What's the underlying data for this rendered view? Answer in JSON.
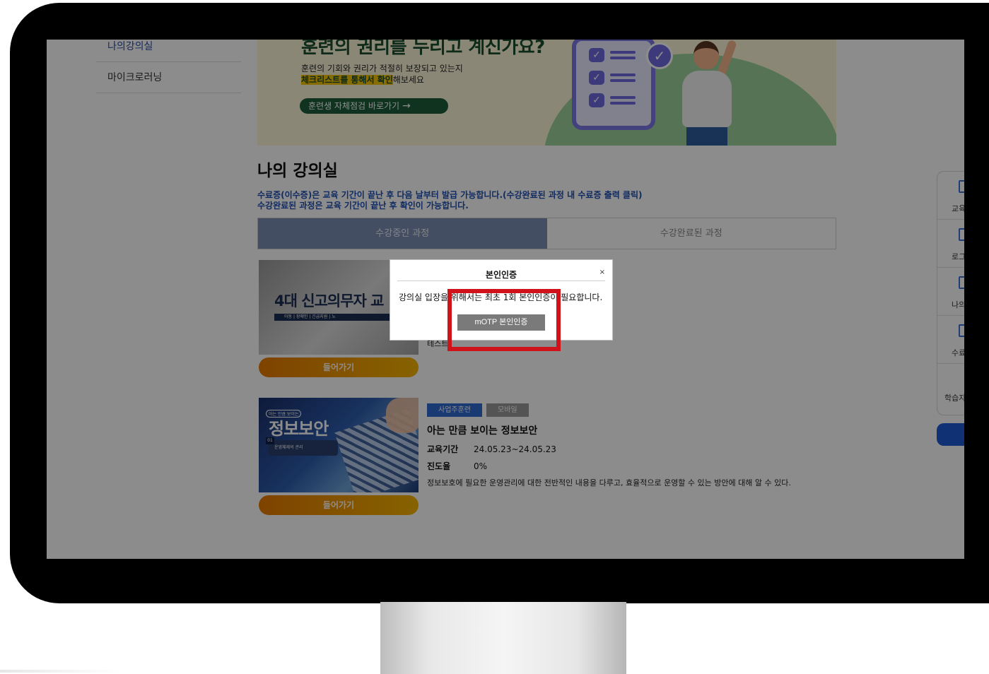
{
  "sidebar": {
    "items": [
      {
        "label": "나의강의실"
      },
      {
        "label": "마이크로러닝"
      }
    ]
  },
  "banner": {
    "title": "훈련의 권리를 누리고 계신가요?",
    "line1": "훈련의 기회와 권리가 적절히 보장되고 있는지",
    "line2_highlight": "체크리스트를 통해서 확인",
    "line2_rest": "해보세요",
    "cta_label": "훈련생 자체점검 바로가기",
    "cta_arrow": "→"
  },
  "main": {
    "title": "나의 강의실",
    "notice1": "수료증(이수증)은 교육 기간이 끝난 후 다음 날부터 발급 가능합니다.(수강완료된 과정 내 수료증 출력 클릭)",
    "notice2": "수강완료된 과정은 교육 기간이 끝난 후 확인이 가능합니다.",
    "tabs": [
      {
        "label": "수강중인 과정",
        "active": true
      },
      {
        "label": "수강완료된 과정",
        "active": false
      }
    ]
  },
  "courses": [
    {
      "thumb_title": "4대 신고의무자 교",
      "thumb_strip": "아동 | 장애인 | 긴급지원 | 노",
      "partial_text": "테스트",
      "enter_label": "들어가기"
    },
    {
      "thumb_small": "아는 만큼 보이는",
      "thumb_title": "정보보안",
      "thumb_num": "01",
      "thumb_pill": "운영체제의 관리",
      "badges": [
        "사업주훈련",
        "모바일"
      ],
      "title": "아는 만큼 보이는 정보보안",
      "period_label": "교육기간",
      "period_value": "24.05.23~24.05.23",
      "progress_label": "진도율",
      "progress_value": "0%",
      "description": "정보보호에 필요한 운영관리에 대한 전반적인 내용을 다루고, 효율적으로 운영할 수 있는 방안에 대해 알 수 있다.",
      "enter_label": "들어가기"
    }
  ],
  "quick_menu": {
    "items": [
      {
        "label": "교육"
      },
      {
        "label": "로그"
      },
      {
        "label": "나의"
      },
      {
        "label": "수료"
      },
      {
        "label": "학습자"
      }
    ]
  },
  "modal": {
    "title": "본인인증",
    "close": "×",
    "message": "강의실 입장을 위해서는 최초 1회 본인인증이 필요합니다.",
    "button": "mOTP 본인인증"
  },
  "colors": {
    "highlight": "#d0121b",
    "tab_active": "#7b8fb4",
    "accent_blue": "#1e4fb3",
    "enter_button": "#f5b400"
  }
}
